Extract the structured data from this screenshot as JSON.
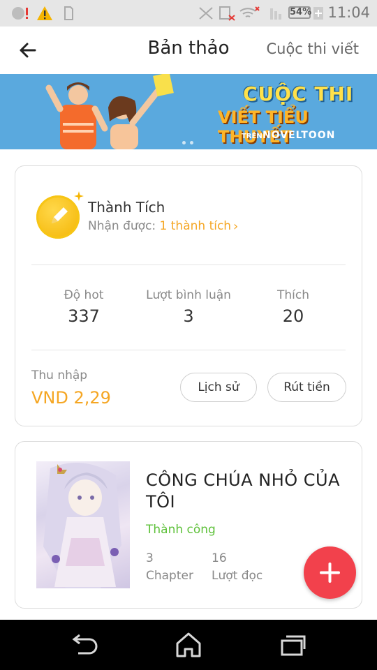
{
  "status_bar": {
    "battery_label": "54%",
    "time": "11:04",
    "icons": [
      "notification-icon",
      "warning-icon",
      "sd-card-icon",
      "bluetooth-off-icon",
      "signal-off-icon",
      "wifi-icon",
      "no-sim-icon",
      "battery-icon"
    ]
  },
  "header": {
    "title": "Bản thảo",
    "contest_link": "Cuộc thi viết"
  },
  "banner": {
    "line1": "CUỘC THI",
    "line2": "VIẾT TIỂU THUYẾT",
    "sub": "TRÊN",
    "brand": "NOVELTOON"
  },
  "achievements": {
    "title": "Thành Tích",
    "received_prefix": "Nhận được:",
    "received_value": "1 thành tích",
    "arrow": "›"
  },
  "stats": [
    {
      "label": "Độ hot",
      "value": "337"
    },
    {
      "label": "Lượt bình luận",
      "value": "3"
    },
    {
      "label": "Thích",
      "value": "20"
    }
  ],
  "income": {
    "label": "Thu nhập",
    "value": "VND 2,29",
    "history_button": "Lịch sử",
    "withdraw_button": "Rút tiền"
  },
  "book": {
    "title": "CÔNG CHÚA NHỎ CỦA TÔI",
    "status": "Thành công",
    "chapters_value": "3",
    "chapters_label": "Chapter",
    "reads_value": "16",
    "reads_label": "Lượt đọc"
  },
  "colors": {
    "accent_orange": "#f5a623",
    "status_green": "#5ec13a",
    "fab_red": "#f2414c",
    "banner_blue": "#5aa9de"
  }
}
